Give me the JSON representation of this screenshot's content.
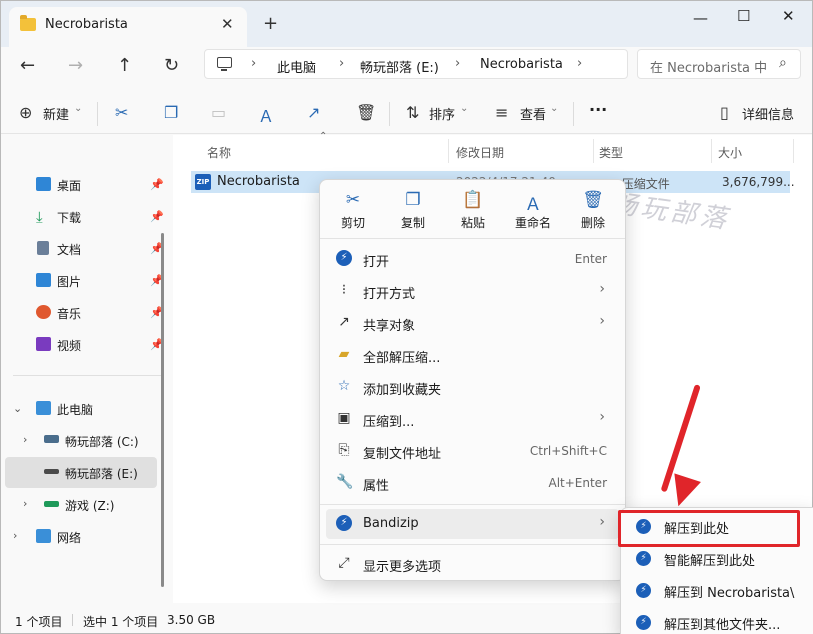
{
  "window": {
    "tab_title": "Necrobarista",
    "tab_close": "✕",
    "new_tab": "+",
    "minimize": "—",
    "maximize": "☐",
    "close": "✕"
  },
  "nav": {
    "back": "←",
    "forward": "→",
    "up": "↑",
    "refresh": "↻",
    "breadcrumbs": [
      "此电脑",
      "畅玩部落 (E:)",
      "Necrobarista"
    ],
    "breadcrumb_sep": "›",
    "search_placeholder": "在 Necrobarista 中"
  },
  "commandbar": {
    "new": "新建",
    "sort": "排序",
    "view": "查看",
    "more": "···",
    "details": "详细信息"
  },
  "sidebar": {
    "quick": [
      {
        "label": "桌面",
        "color": "#2f86d6"
      },
      {
        "label": "下载",
        "color": "#1f9a5a"
      },
      {
        "label": "文档",
        "color": "#6b7f99"
      },
      {
        "label": "图片",
        "color": "#2f86d6"
      },
      {
        "label": "音乐",
        "color": "#e0582f"
      },
      {
        "label": "视频",
        "color": "#7a3bbf"
      }
    ],
    "pc": "此电脑",
    "drives": [
      {
        "label": "畅玩部落 (C:)"
      },
      {
        "label": "畅玩部落 (E:)"
      },
      {
        "label": "游戏 (Z:)"
      }
    ],
    "network": "网络"
  },
  "filelist": {
    "columns": [
      "名称",
      "修改日期",
      "类型",
      "大小"
    ],
    "rows": [
      {
        "name": "Necrobarista",
        "date": "2022/4/17 21:40",
        "type": "ZIP 压缩文件",
        "size": "3,676,799..."
      }
    ],
    "watermark": "畅玩部落"
  },
  "status": {
    "count": "1 个项目",
    "selected": "选中 1 个项目",
    "size": "3.50 GB"
  },
  "context_menu": {
    "quick_actions": [
      {
        "icon": "✂",
        "label": "剪切"
      },
      {
        "icon": "❐",
        "label": "复制"
      },
      {
        "icon": "📋",
        "label": "粘贴"
      },
      {
        "icon": "Ａ",
        "label": "重命名"
      },
      {
        "icon": "🗑",
        "label": "删除"
      }
    ],
    "items": [
      {
        "label": "打开",
        "shortcut": "Enter",
        "arrow": ""
      },
      {
        "label": "打开方式",
        "shortcut": "",
        "arrow": "›"
      },
      {
        "label": "共享对象",
        "shortcut": "",
        "arrow": "›"
      },
      {
        "label": "全部解压缩...",
        "shortcut": "",
        "arrow": ""
      },
      {
        "label": "添加到收藏夹",
        "shortcut": "",
        "arrow": ""
      },
      {
        "label": "压缩到...",
        "shortcut": "",
        "arrow": "›"
      },
      {
        "label": "复制文件地址",
        "shortcut": "Ctrl+Shift+C",
        "arrow": ""
      },
      {
        "label": "属性",
        "shortcut": "Alt+Enter",
        "arrow": ""
      }
    ],
    "bandizip": "Bandizip",
    "more_options": "显示更多选项"
  },
  "submenu": {
    "items": [
      "解压到此处",
      "智能解压到此处",
      "解压到 Necrobarista\\",
      "解压到其他文件夹..."
    ]
  },
  "colors": {
    "highlight_red": "#e0252a",
    "selection_blue": "#cde4f7",
    "bandizip_blue": "#1c5fb8"
  }
}
